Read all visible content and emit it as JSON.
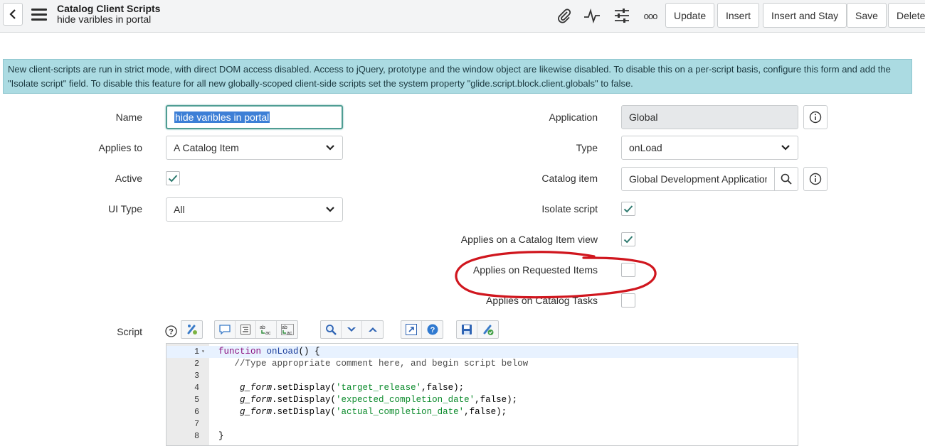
{
  "header": {
    "record_type": "Catalog Client Scripts",
    "record_name": "hide varibles in portal",
    "icons": [
      "back-icon",
      "menu-icon",
      "paperclip-icon",
      "activity-icon",
      "sliders-icon",
      "more-icon"
    ],
    "more_label": "ooo",
    "buttons": {
      "update": "Update",
      "insert": "Insert",
      "insert_and_stay": "Insert and Stay",
      "save": "Save",
      "delete": "Delete"
    }
  },
  "notice": {
    "text": "New client-scripts are run in strict mode, with direct DOM access disabled. Access to jQuery, prototype and the window object are likewise disabled. To disable this on a per-script basis, configure this form and add the \"Isolate script\" field. To disable this feature for all new globally-scoped client-side scripts set the system property \"glide.script.block.client.globals\" to false."
  },
  "form": {
    "name": {
      "label": "Name",
      "value": "hide varibles in portal"
    },
    "applies_to": {
      "label": "Applies to",
      "value": "A Catalog Item"
    },
    "active": {
      "label": "Active",
      "checked": true
    },
    "ui_type": {
      "label": "UI Type",
      "value": "All"
    },
    "application": {
      "label": "Application",
      "value": "Global"
    },
    "type": {
      "label": "Type",
      "value": "onLoad"
    },
    "catalog_item": {
      "label": "Catalog item",
      "value": "Global Development Application"
    },
    "isolate_script": {
      "label": "Isolate script",
      "checked": true
    },
    "applies_catalog_item_view": {
      "label": "Applies on a Catalog Item view",
      "checked": true
    },
    "applies_requested_items": {
      "label": "Applies on Requested Items",
      "checked": false
    },
    "applies_catalog_tasks": {
      "label": "Applies on Catalog Tasks",
      "checked": false
    }
  },
  "script": {
    "label": "Script",
    "help_icon": "help-icon",
    "toolbar_icons": [
      "script-include-icon",
      "comment-icon",
      "format-icon",
      "replace-icon",
      "replace-all-icon",
      "search-icon",
      "next-icon",
      "prev-icon",
      "fullscreen-icon",
      "help-circle-icon",
      "save-icon",
      "syntax-check-icon"
    ],
    "lines": [
      {
        "n": "1",
        "text": "function onLoad() {"
      },
      {
        "n": "2",
        "text": "   //Type appropriate comment here, and begin script below"
      },
      {
        "n": "3",
        "text": ""
      },
      {
        "n": "4",
        "text": "    g_form.setDisplay('target_release',false);"
      },
      {
        "n": "5",
        "text": "    g_form.setDisplay('expected_completion_date',false);"
      },
      {
        "n": "6",
        "text": "    g_form.setDisplay('actual_completion_date',false);"
      },
      {
        "n": "7",
        "text": ""
      },
      {
        "n": "8",
        "text": "}"
      }
    ]
  },
  "colors": {
    "notice_bg": "#abdbe2",
    "focus_border": "#4f9d93",
    "check": "#2e7a6f",
    "annotation": "#d0161e"
  }
}
